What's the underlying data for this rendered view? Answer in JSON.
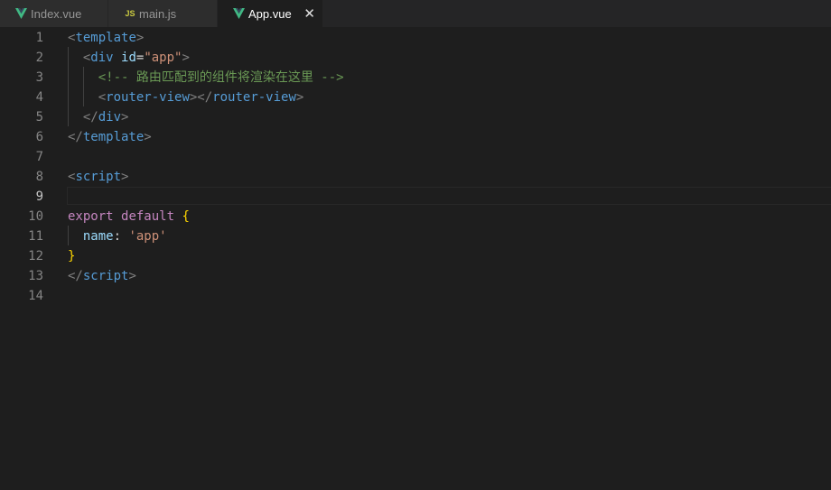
{
  "tabs": [
    {
      "label": "Index.vue",
      "icon": "vue-icon",
      "active": false
    },
    {
      "label": "main.js",
      "icon": "js-icon",
      "icon_text": "JS",
      "active": false
    },
    {
      "label": "App.vue",
      "icon": "vue-icon",
      "active": true,
      "close_glyph": "✕"
    }
  ],
  "colors": {
    "vue_green": "#41b883",
    "js_yellow": "#cbcb41",
    "editor_bg": "#1e1e1e",
    "tag_blue": "#569cd6",
    "comment_green": "#6a9955",
    "string_orange": "#ce9178",
    "keyword_purple": "#c586c0"
  },
  "editor": {
    "current_line": 9,
    "line_numbers": [
      "1",
      "2",
      "3",
      "4",
      "5",
      "6",
      "7",
      "8",
      "9",
      "10",
      "11",
      "12",
      "13",
      "14"
    ],
    "code": {
      "l1": {
        "open": "<",
        "tag": "template",
        "close": ">"
      },
      "l2": {
        "open": "<",
        "tag": "div",
        "attr": "id",
        "eq": "=",
        "value": "\"app\"",
        "close": ">"
      },
      "l3": {
        "comment": "<!-- 路由匹配到的组件将渲染在这里 -->"
      },
      "l4": {
        "open": "<",
        "tag": "router-view",
        "mid": "></",
        "tag2": "router-view",
        "close": ">"
      },
      "l5": {
        "open": "</",
        "tag": "div",
        "close": ">"
      },
      "l6": {
        "open": "</",
        "tag": "template",
        "close": ">"
      },
      "l8": {
        "open": "<",
        "tag": "script",
        "close": ">"
      },
      "l10": {
        "kw1": "export",
        "kw2": "default",
        "brace": "{"
      },
      "l11": {
        "prop": "name",
        "colon": ":",
        "value": "'app'"
      },
      "l12": {
        "brace": "}"
      },
      "l13": {
        "open": "</",
        "tag": "script",
        "close": ">"
      }
    }
  }
}
